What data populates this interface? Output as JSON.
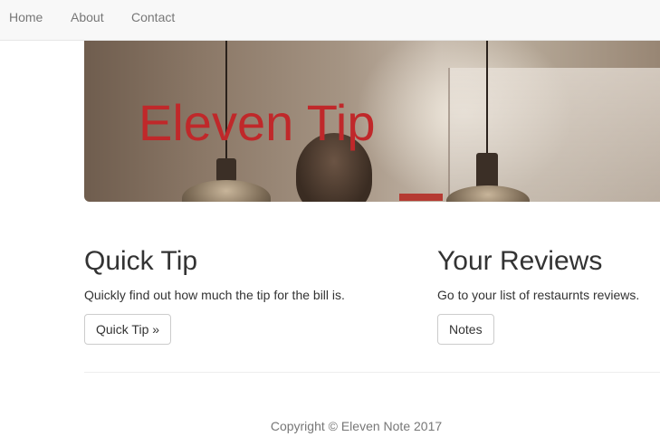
{
  "nav": {
    "items": [
      {
        "label": "Home"
      },
      {
        "label": "About"
      },
      {
        "label": "Contact"
      }
    ]
  },
  "hero": {
    "title": "Eleven Tip"
  },
  "columns": [
    {
      "heading": "Quick Tip",
      "text": "Quickly find out how much the tip for the bill is.",
      "button": "Quick Tip »"
    },
    {
      "heading": "Your Reviews",
      "text": "Go to your list of restaurnts reviews.",
      "button": "Notes"
    }
  ],
  "footer": {
    "text": "Copyright © Eleven Note 2017"
  },
  "colors": {
    "hero_title": "#c0282a",
    "navbar_bg": "#f8f8f8",
    "nav_link": "#777777"
  }
}
